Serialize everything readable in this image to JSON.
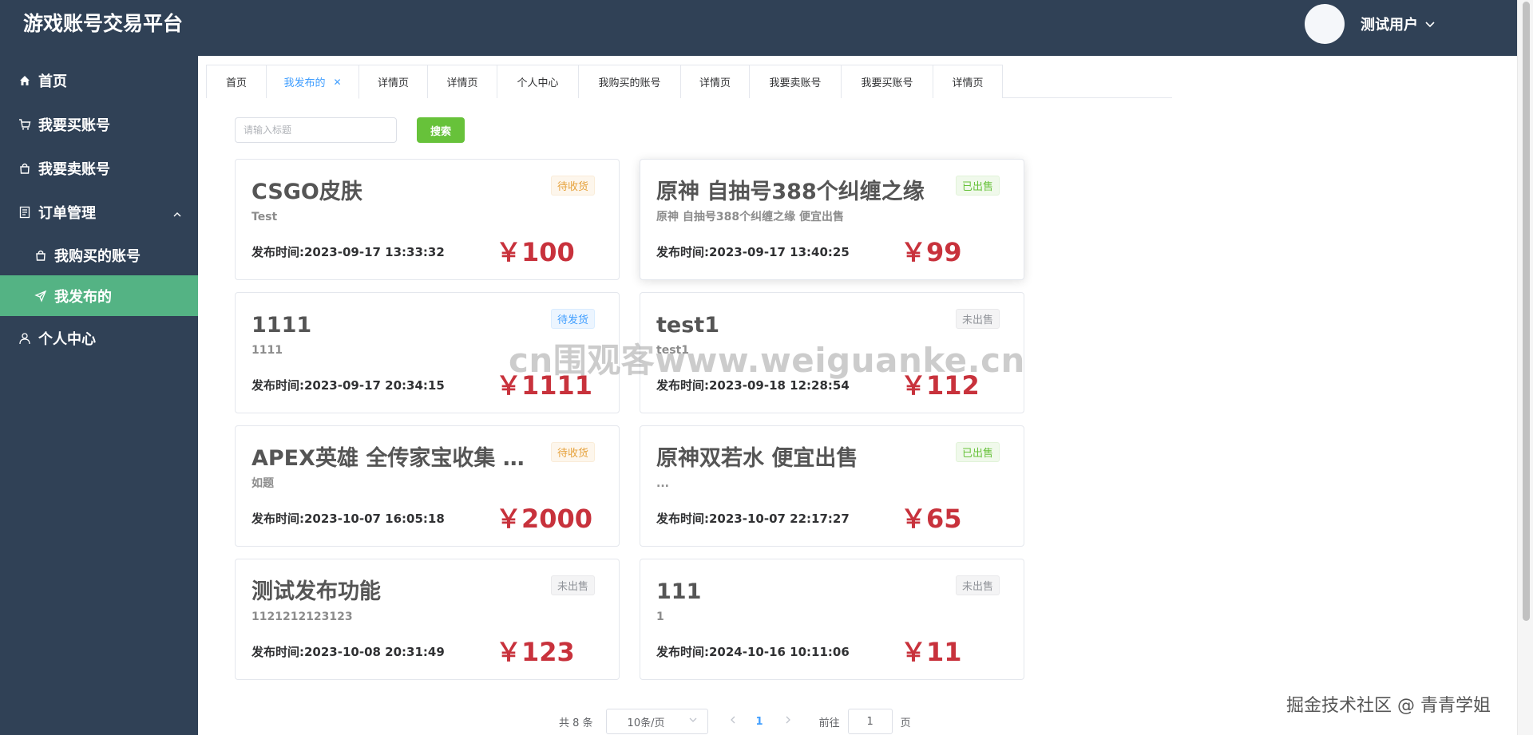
{
  "app": {
    "title": "游戏账号交易平台",
    "user_name": "测试用户"
  },
  "sidebar": {
    "items": [
      {
        "label": "首页",
        "icon": "home-icon"
      },
      {
        "label": "我要买账号",
        "icon": "cart-icon"
      },
      {
        "label": "我要卖账号",
        "icon": "bag-icon"
      },
      {
        "label": "订单管理",
        "icon": "document-icon",
        "expanded": true
      },
      {
        "label": "我购买的账号",
        "icon": "bag-icon"
      },
      {
        "label": "我发布的",
        "icon": "send-icon",
        "active": true
      },
      {
        "label": "个人中心",
        "icon": "user-icon"
      }
    ]
  },
  "tabs": [
    {
      "label": "首页"
    },
    {
      "label": "我发布的",
      "active": true
    },
    {
      "label": "详情页"
    },
    {
      "label": "详情页"
    },
    {
      "label": "个人中心"
    },
    {
      "label": "我购买的账号"
    },
    {
      "label": "详情页"
    },
    {
      "label": "我要卖账号"
    },
    {
      "label": "我要买账号"
    },
    {
      "label": "详情页"
    }
  ],
  "search": {
    "placeholder": "请输入标题",
    "button_label": "搜索"
  },
  "cards": [
    {
      "title": "CSGO皮肤",
      "subtitle": "Test",
      "time": "发布时间:2023-09-17 13:33:32",
      "price": "￥100",
      "status": "待收货",
      "status_type": "warning"
    },
    {
      "title": "原神 自抽号388个纠缠之缘",
      "subtitle": "原神 自抽号388个纠缠之缘 便宜出售",
      "time": "发布时间:2023-09-17 13:40:25",
      "price": "￥99",
      "status": "已出售",
      "status_type": "success"
    },
    {
      "title": "1111",
      "subtitle": "1111",
      "time": "发布时间:2023-09-17 20:34:15",
      "price": "￥1111",
      "status": "待发货",
      "status_type": "primary"
    },
    {
      "title": "test1",
      "subtitle": "test1",
      "time": "发布时间:2023-09-18 12:28:54",
      "price": "￥112",
      "status": "未出售",
      "status_type": "info"
    },
    {
      "title": "APEX英雄 全传家宝收集 s...",
      "subtitle": "如题",
      "time": "发布时间:2023-10-07 16:05:18",
      "price": "￥2000",
      "status": "待收货",
      "status_type": "warning"
    },
    {
      "title": "原神双若水 便宜出售",
      "subtitle": "...",
      "time": "发布时间:2023-10-07 22:17:27",
      "price": "￥65",
      "status": "已出售",
      "status_type": "success"
    },
    {
      "title": "测试发布功能",
      "subtitle": "1121212123123",
      "time": "发布时间:2023-10-08 20:31:49",
      "price": "￥123",
      "status": "未出售",
      "status_type": "info"
    },
    {
      "title": "111",
      "subtitle": "1",
      "time": "发布时间:2024-10-16 10:11:06",
      "price": "￥11",
      "status": "未出售",
      "status_type": "info"
    }
  ],
  "pagination": {
    "total": "共 8 条",
    "page_size": "10条/页",
    "current_page": "1",
    "goto_label": "前往",
    "goto_value": "1",
    "page_unit": "页"
  },
  "status_colors": {
    "warning": {
      "fg": "#e6a23c",
      "bg": "#fdf6ec",
      "border": "#faecd8"
    },
    "success": {
      "fg": "#67c23a",
      "bg": "#f0f9eb",
      "border": "#e1f3d8"
    },
    "primary": {
      "fg": "#409eff",
      "bg": "#ecf5ff",
      "border": "#d9ecff"
    },
    "info": {
      "fg": "#909399",
      "bg": "#f4f4f5",
      "border": "#e9e9eb"
    }
  },
  "colors": {
    "sidebar_bg": "#304156",
    "sidebar_active": "#54b384",
    "price": "#c8323c",
    "search_button": "#67c23a"
  },
  "overlay": {
    "watermark": "cn围观客www.weiguanke.cn",
    "credit": "掘金技术社区 @ 青青学姐"
  }
}
